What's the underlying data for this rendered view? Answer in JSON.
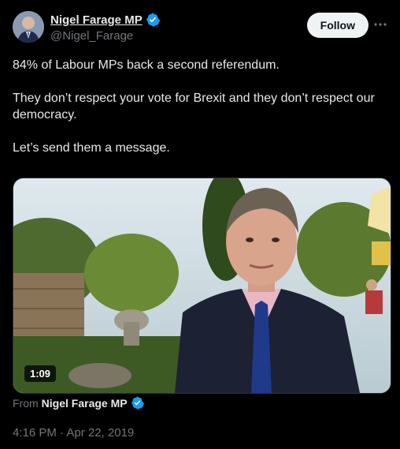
{
  "author": {
    "display_name": "Nigel Farage MP",
    "handle": "@Nigel_Farage"
  },
  "follow_label": "Follow",
  "more_icon": "more-icon",
  "tweet": {
    "paragraphs": [
      "84% of Labour MPs back a second referendum.",
      "They don’t respect your vote for Brexit and they don’t respect our democracy.",
      "Let’s send them a message."
    ]
  },
  "media": {
    "duration": "1:09"
  },
  "from": {
    "prefix": "From",
    "source": "Nigel Farage MP"
  },
  "timestamp": "4:16 PM · Apr 22, 2019",
  "colors": {
    "verified": "#1d9bf0",
    "background": "#000000",
    "text": "#e7e9ea",
    "muted": "#71767b"
  }
}
